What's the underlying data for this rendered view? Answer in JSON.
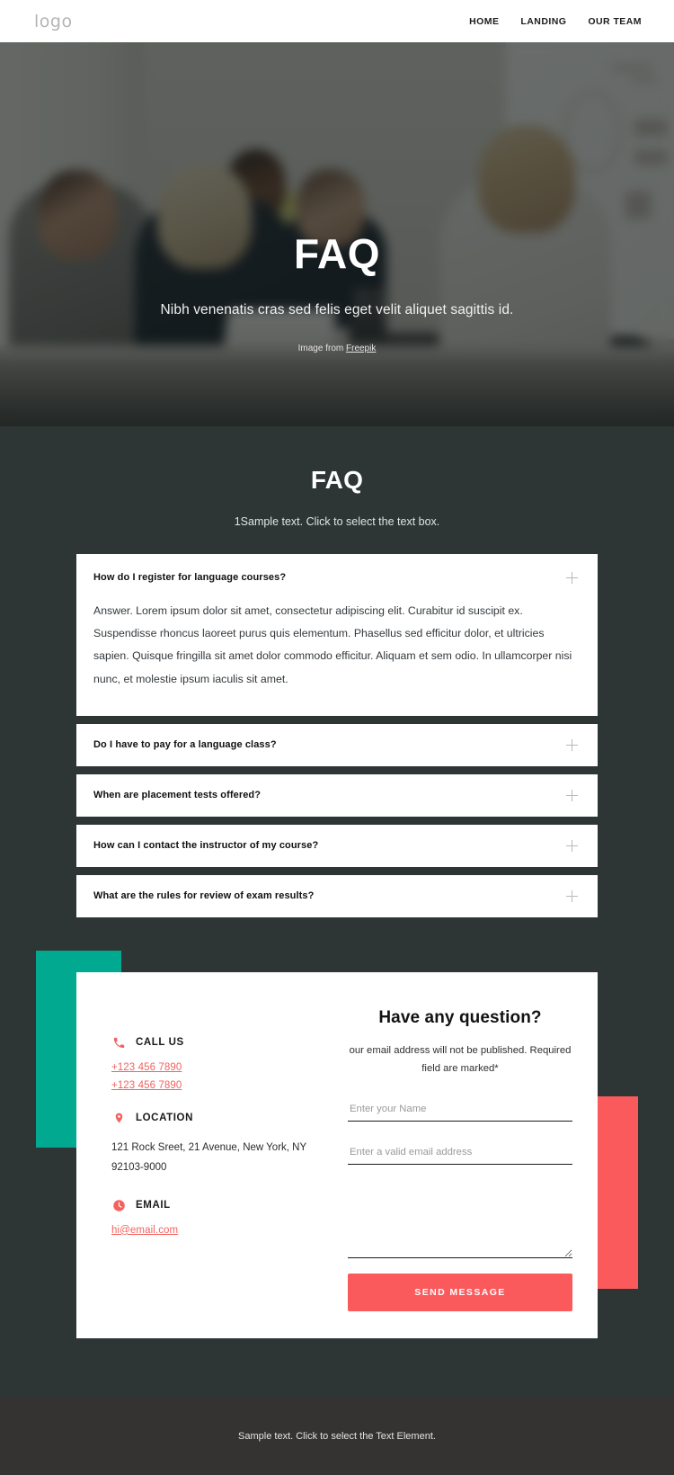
{
  "navbar": {
    "logo": "logo",
    "links": [
      {
        "label": "HOME"
      },
      {
        "label": "LANDING"
      },
      {
        "label": "OUR TEAM"
      }
    ]
  },
  "hero": {
    "title": "FAQ",
    "subtitle": "Nibh venenatis cras sed felis eget velit aliquet sagittis id.",
    "credit_prefix": "Image from ",
    "credit_link": "Freepik"
  },
  "faq": {
    "heading": "FAQ",
    "subheading": "1Sample text. Click to select the text box.",
    "items": [
      {
        "question": "How do I register for language courses?",
        "answer": "Answer. Lorem ipsum dolor sit amet, consectetur adipiscing elit. Curabitur id suscipit ex. Suspendisse rhoncus laoreet purus quis elementum. Phasellus sed efficitur dolor, et ultricies sapien. Quisque fringilla sit amet dolor commodo efficitur. Aliquam et sem odio. In ullamcorper nisi nunc, et molestie ipsum iaculis sit amet.",
        "open": true,
        "toggle_icon": "plus-icon"
      },
      {
        "question": "Do I have to pay for a language class?",
        "answer": "",
        "open": false,
        "toggle_icon": "plus-icon"
      },
      {
        "question": "When are placement tests offered?",
        "answer": "",
        "open": false,
        "toggle_icon": "plus-icon"
      },
      {
        "question": "How can I contact the instructor of my course?",
        "answer": "",
        "open": false,
        "toggle_icon": "plus-icon"
      },
      {
        "question": "What are the rules for review of exam results?",
        "answer": "",
        "open": false,
        "toggle_icon": "plus-icon"
      }
    ]
  },
  "contact": {
    "call": {
      "icon": "phone-icon",
      "label": "CALL US",
      "phone_1": "+123 456 7890",
      "phone_2": "+123 456 7890"
    },
    "location": {
      "icon": "map-pin-icon",
      "label": "LOCATION",
      "address": "121 Rock Sreet, 21 Avenue, New York, NY 92103-9000"
    },
    "email": {
      "icon": "clock-icon",
      "label": "EMAIL",
      "address": "hi@email.com"
    },
    "form": {
      "title": "Have any question?",
      "note": "our email address will not be published. Required field are marked*",
      "name_placeholder": "Enter your Name",
      "email_placeholder": "Enter a valid email address",
      "message_placeholder": "",
      "submit_label": "SEND MESSAGE"
    }
  },
  "footer": {
    "text": "Sample text. Click to select the Text Element."
  },
  "colors": {
    "background": "#2d3635",
    "footer_background": "#353331",
    "accent_red": "#fa5a5c",
    "accent_teal": "#00a98f",
    "card_white": "#ffffff",
    "link_red": "#f4625f"
  }
}
